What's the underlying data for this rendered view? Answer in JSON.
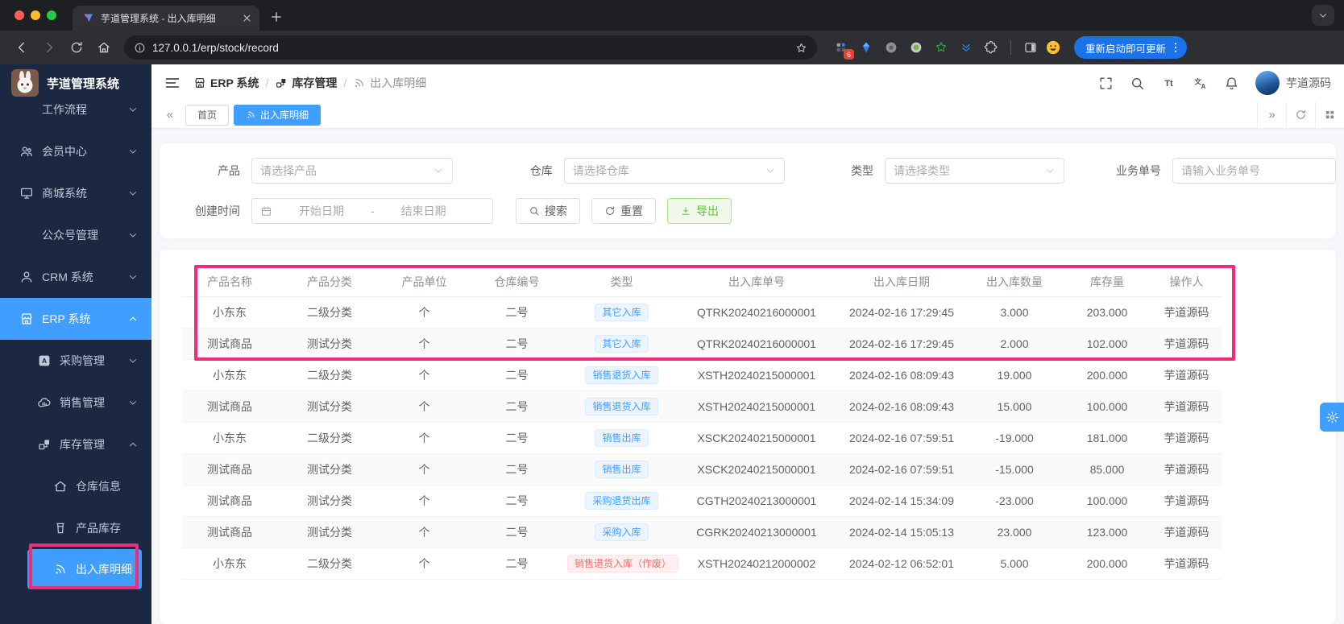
{
  "colors": {
    "primary": "#409eff",
    "annotation": "#ec2d7a",
    "badge_in_text": "#409eff",
    "badge_in_bg": "#ecf5ff",
    "badge_void_text": "#f56c6c",
    "badge_void_bg": "#fef0f0",
    "export_text": "#67c23a",
    "update_button_bg": "#1a73e8",
    "sidebar_bg": "#1c2741"
  },
  "browser": {
    "window_controls": [
      "close",
      "minimize",
      "zoom"
    ],
    "tab": {
      "title": "芋道管理系统 - 出入库明细",
      "favicon": "yudao-logo",
      "close_icon": "close"
    },
    "new_tab_icon": "plus",
    "tab_search_icon": "chevron-down",
    "nav_icons": [
      {
        "icon": "back",
        "disabled": false
      },
      {
        "icon": "forward",
        "disabled": true
      },
      {
        "icon": "refresh",
        "disabled": false
      },
      {
        "icon": "home",
        "disabled": false
      }
    ],
    "url_info_icon": "info",
    "url": "127.0.0.1/erp/stock/record",
    "bookmark_icon": "star",
    "extensions": [
      {
        "icon": "ext-grid",
        "badge": "6"
      },
      {
        "icon": "kite"
      },
      {
        "icon": "circle-pattern"
      },
      {
        "icon": "circle-dot"
      },
      {
        "icon": "star-green"
      },
      {
        "icon": "double-chevron"
      },
      {
        "icon": "puzzle"
      }
    ],
    "split_icon": "split",
    "profile_icon": "emoji",
    "update_button": "重新启动即可更新",
    "menu_icon": "dots-vertical"
  },
  "sidebar": {
    "title": "芋道管理系统",
    "menu": [
      {
        "id": "workflow",
        "label": "工作流程",
        "icon": null,
        "level": 1,
        "chevron": "down",
        "active": false
      },
      {
        "id": "member",
        "label": "会员中心",
        "icon": "member",
        "level": 1,
        "chevron": "down",
        "active": false
      },
      {
        "id": "mall",
        "label": "商城系统",
        "icon": "mall",
        "level": 1,
        "chevron": "down",
        "active": false
      },
      {
        "id": "mp",
        "label": "公众号管理",
        "icon": null,
        "level": 1,
        "chevron": "down",
        "active": false
      },
      {
        "id": "crm",
        "label": "CRM 系统",
        "icon": "user",
        "level": 1,
        "chevron": "down",
        "active": false
      },
      {
        "id": "erp",
        "label": "ERP 系统",
        "icon": "shop",
        "level": 1,
        "chevron": "up",
        "active": true
      },
      {
        "id": "purchase",
        "label": "采购管理",
        "icon": "purchase",
        "level": 2,
        "chevron": "down",
        "active": false
      },
      {
        "id": "sales",
        "label": "销售管理",
        "icon": "sales",
        "level": 2,
        "chevron": "down",
        "active": false
      },
      {
        "id": "stock",
        "label": "库存管理",
        "icon": "stock",
        "level": 2,
        "chevron": "up",
        "active": false
      },
      {
        "id": "warehouse-info",
        "label": "仓库信息",
        "icon": "warehouse",
        "level": 3,
        "chevron": null,
        "active": false
      },
      {
        "id": "product-stock",
        "label": "产品库存",
        "icon": "product",
        "level": 3,
        "chevron": null,
        "active": false
      },
      {
        "id": "stock-record",
        "label": "出入库明细",
        "icon": "record",
        "level": 3,
        "chevron": null,
        "active": true
      }
    ]
  },
  "header": {
    "menu_icon": "menu",
    "breadcrumb": [
      {
        "label": "ERP 系统",
        "icon": "shop"
      },
      {
        "label": "库存管理",
        "icon": "stock"
      },
      {
        "label": "出入库明细",
        "icon": "record"
      }
    ],
    "separator": "/",
    "actions": [
      "fullscreen",
      "search",
      "font-size",
      "translate",
      "bell"
    ],
    "username": "芋道源码"
  },
  "tabbar": {
    "prev_symbol": "«",
    "next_symbol": "»",
    "tabs": [
      {
        "label": "首页",
        "icon": null,
        "active": false
      },
      {
        "label": "出入库明细",
        "icon": "record",
        "active": true
      }
    ],
    "controls": [
      "refresh",
      "grid"
    ]
  },
  "filters": {
    "product": {
      "label": "产品",
      "placeholder": "请选择产品"
    },
    "warehouse": {
      "label": "仓库",
      "placeholder": "请选择仓库"
    },
    "type": {
      "label": "类型",
      "placeholder": "请选择类型"
    },
    "business_no": {
      "label": "业务单号",
      "placeholder": "请输入业务单号"
    },
    "create_time": {
      "label": "创建时间",
      "icon": "calendar",
      "start_placeholder": "开始日期",
      "separator": "-",
      "end_placeholder": "结束日期"
    },
    "buttons": {
      "search": {
        "label": "搜索",
        "icon": "search"
      },
      "reset": {
        "label": "重置",
        "icon": "refresh"
      },
      "export": {
        "label": "导出",
        "icon": "download"
      }
    }
  },
  "table": {
    "columns": [
      "产品名称",
      "产品分类",
      "产品单位",
      "仓库编号",
      "类型",
      "出入库单号",
      "出入库日期",
      "出入库数量",
      "库存量",
      "操作人"
    ],
    "rows": [
      {
        "product": "小东东",
        "category": "二级分类",
        "unit": "个",
        "warehouse": "二号",
        "type": {
          "label": "其它入库",
          "variant": "in"
        },
        "order_no": "QTRK20240216000001",
        "datetime": "2024-02-16 17:29:45",
        "quantity": "3.000",
        "stock": "203.000",
        "operator": "芋道源码"
      },
      {
        "product": "测试商品",
        "category": "测试分类",
        "unit": "个",
        "warehouse": "二号",
        "type": {
          "label": "其它入库",
          "variant": "in"
        },
        "order_no": "QTRK20240216000001",
        "datetime": "2024-02-16 17:29:45",
        "quantity": "2.000",
        "stock": "102.000",
        "operator": "芋道源码"
      },
      {
        "product": "小东东",
        "category": "二级分类",
        "unit": "个",
        "warehouse": "二号",
        "type": {
          "label": "销售退货入库",
          "variant": "in"
        },
        "order_no": "XSTH20240215000001",
        "datetime": "2024-02-16 08:09:43",
        "quantity": "19.000",
        "stock": "200.000",
        "operator": "芋道源码"
      },
      {
        "product": "测试商品",
        "category": "测试分类",
        "unit": "个",
        "warehouse": "二号",
        "type": {
          "label": "销售退货入库",
          "variant": "in"
        },
        "order_no": "XSTH20240215000001",
        "datetime": "2024-02-16 08:09:43",
        "quantity": "15.000",
        "stock": "100.000",
        "operator": "芋道源码"
      },
      {
        "product": "小东东",
        "category": "二级分类",
        "unit": "个",
        "warehouse": "二号",
        "type": {
          "label": "销售出库",
          "variant": "in"
        },
        "order_no": "XSCK20240215000001",
        "datetime": "2024-02-16 07:59:51",
        "quantity": "-19.000",
        "stock": "181.000",
        "operator": "芋道源码"
      },
      {
        "product": "测试商品",
        "category": "测试分类",
        "unit": "个",
        "warehouse": "二号",
        "type": {
          "label": "销售出库",
          "variant": "in"
        },
        "order_no": "XSCK20240215000001",
        "datetime": "2024-02-16 07:59:51",
        "quantity": "-15.000",
        "stock": "85.000",
        "operator": "芋道源码"
      },
      {
        "product": "测试商品",
        "category": "测试分类",
        "unit": "个",
        "warehouse": "二号",
        "type": {
          "label": "采购退货出库",
          "variant": "in"
        },
        "order_no": "CGTH20240213000001",
        "datetime": "2024-02-14 15:34:09",
        "quantity": "-23.000",
        "stock": "100.000",
        "operator": "芋道源码"
      },
      {
        "product": "测试商品",
        "category": "测试分类",
        "unit": "个",
        "warehouse": "二号",
        "type": {
          "label": "采购入库",
          "variant": "in"
        },
        "order_no": "CGRK20240213000001",
        "datetime": "2024-02-14 15:05:13",
        "quantity": "23.000",
        "stock": "123.000",
        "operator": "芋道源码"
      },
      {
        "product": "小东东",
        "category": "二级分类",
        "unit": "个",
        "warehouse": "二号",
        "type": {
          "label": "销售退货入库（作废）",
          "variant": "void"
        },
        "order_no": "XSTH20240212000002",
        "datetime": "2024-02-12 06:52:01",
        "quantity": "5.000",
        "stock": "200.000",
        "operator": "芋道源码"
      }
    ]
  },
  "settings_button_icon": "gear"
}
